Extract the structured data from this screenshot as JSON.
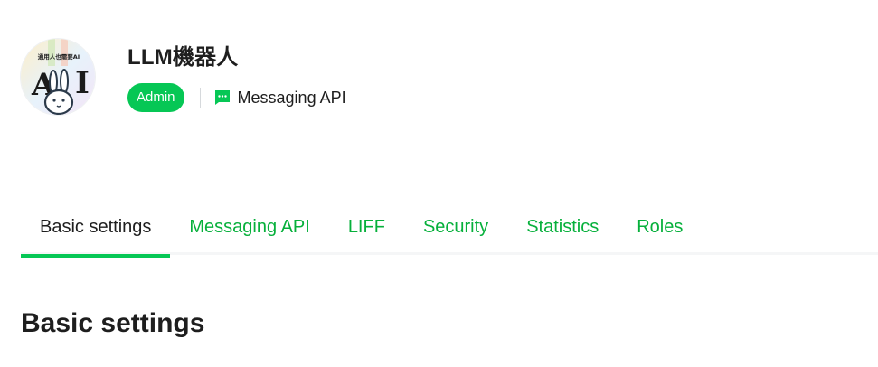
{
  "channel": {
    "name": "LLM機器人",
    "role_badge": "Admin",
    "channel_type": "Messaging API",
    "avatar_caption": "通用人也需要AI",
    "avatar_letters": "AI"
  },
  "tabs": [
    {
      "label": "Basic settings",
      "active": true
    },
    {
      "label": "Messaging API",
      "active": false
    },
    {
      "label": "LIFF",
      "active": false
    },
    {
      "label": "Security",
      "active": false
    },
    {
      "label": "Statistics",
      "active": false
    },
    {
      "label": "Roles",
      "active": false
    }
  ],
  "section": {
    "title": "Basic settings"
  },
  "colors": {
    "brand_green": "#06c755",
    "tab_text_green": "#06b03b",
    "text_dark": "#1e1e1e"
  },
  "icons": {
    "channel_type": "chat-bubble-icon"
  }
}
